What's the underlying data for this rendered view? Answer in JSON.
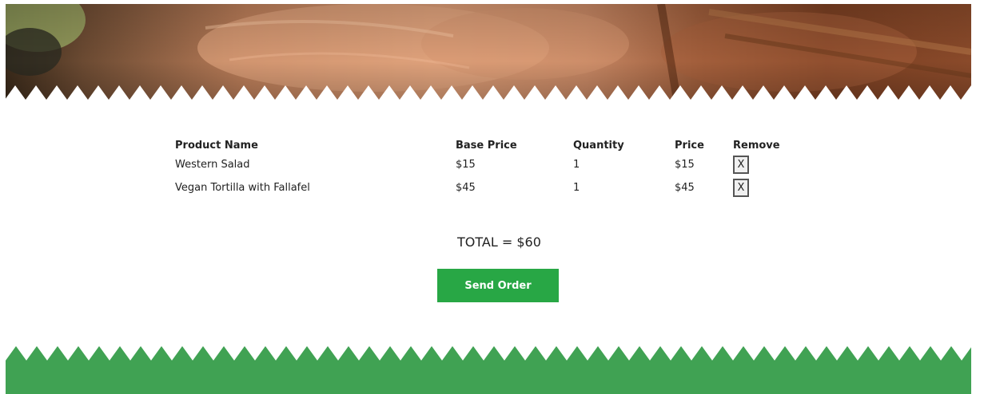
{
  "colors": {
    "accent": "#28a745",
    "footer": "#40a253"
  },
  "hero": {
    "image": "grilled-food-photo"
  },
  "cart": {
    "headers": {
      "product_name": "Product Name",
      "base_price": "Base Price",
      "quantity": "Quantity",
      "price": "Price",
      "remove": "Remove"
    },
    "rows": [
      {
        "name": "Western Salad",
        "base_price": "$15",
        "quantity": "1",
        "price": "$15",
        "remove_label": "X"
      },
      {
        "name": "Vegan Tortilla with Fallafel",
        "base_price": "$45",
        "quantity": "1",
        "price": "$45",
        "remove_label": "X"
      }
    ]
  },
  "total": {
    "text": "TOTAL = $60"
  },
  "actions": {
    "send_order": "Send Order"
  }
}
